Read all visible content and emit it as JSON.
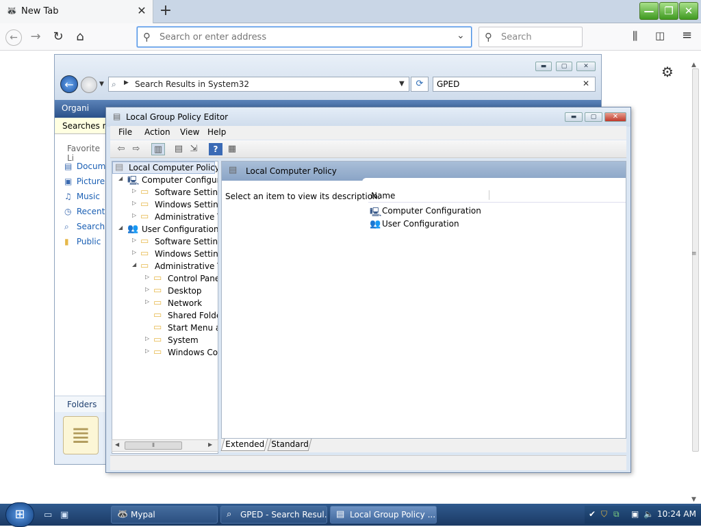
{
  "browser": {
    "tab": {
      "title": "New Tab",
      "favicon": "mypal-icon"
    },
    "urlbar": {
      "placeholder": "Search or enter address"
    },
    "searchbar": {
      "placeholder": "Search"
    }
  },
  "explorer": {
    "address": "Search Results in System32",
    "search_value": "GPED",
    "organize": "Organi",
    "infobar": "Searches mi",
    "favorites_title": "Favorite Li",
    "favorites": [
      "Docum",
      "Picture",
      "Music",
      "Recent",
      "Search",
      "Public"
    ],
    "folders_label": "Folders"
  },
  "gped": {
    "title": "Local Group Policy Editor",
    "menu": [
      "File",
      "Action",
      "View",
      "Help"
    ],
    "tree": {
      "root": "Local Computer Policy",
      "computer_configuration": "Computer Configura",
      "computer_children": [
        "Software Settings",
        "Windows Setting",
        "Administrative Te"
      ],
      "user_configuration": "User Configuration",
      "user_children": [
        "Software Settings",
        "Windows Setting",
        "Administrative Te"
      ],
      "admin_templates_children": [
        "Control Panel",
        "Desktop",
        "Network",
        "Shared Folder",
        "Start Menu ar",
        "System",
        "Windows Cor"
      ]
    },
    "header_title": "Local Computer Policy",
    "description": "Select an item to view its description.",
    "column_name": "Name",
    "items": [
      "Computer Configuration",
      "User Configuration"
    ],
    "tabs": {
      "extended": "Extended",
      "standard": "Standard"
    }
  },
  "taskbar": {
    "tasks": [
      "Mypal",
      "GPED - Search Resul...",
      "Local Group Policy ..."
    ],
    "clock": "10:24 AM"
  }
}
